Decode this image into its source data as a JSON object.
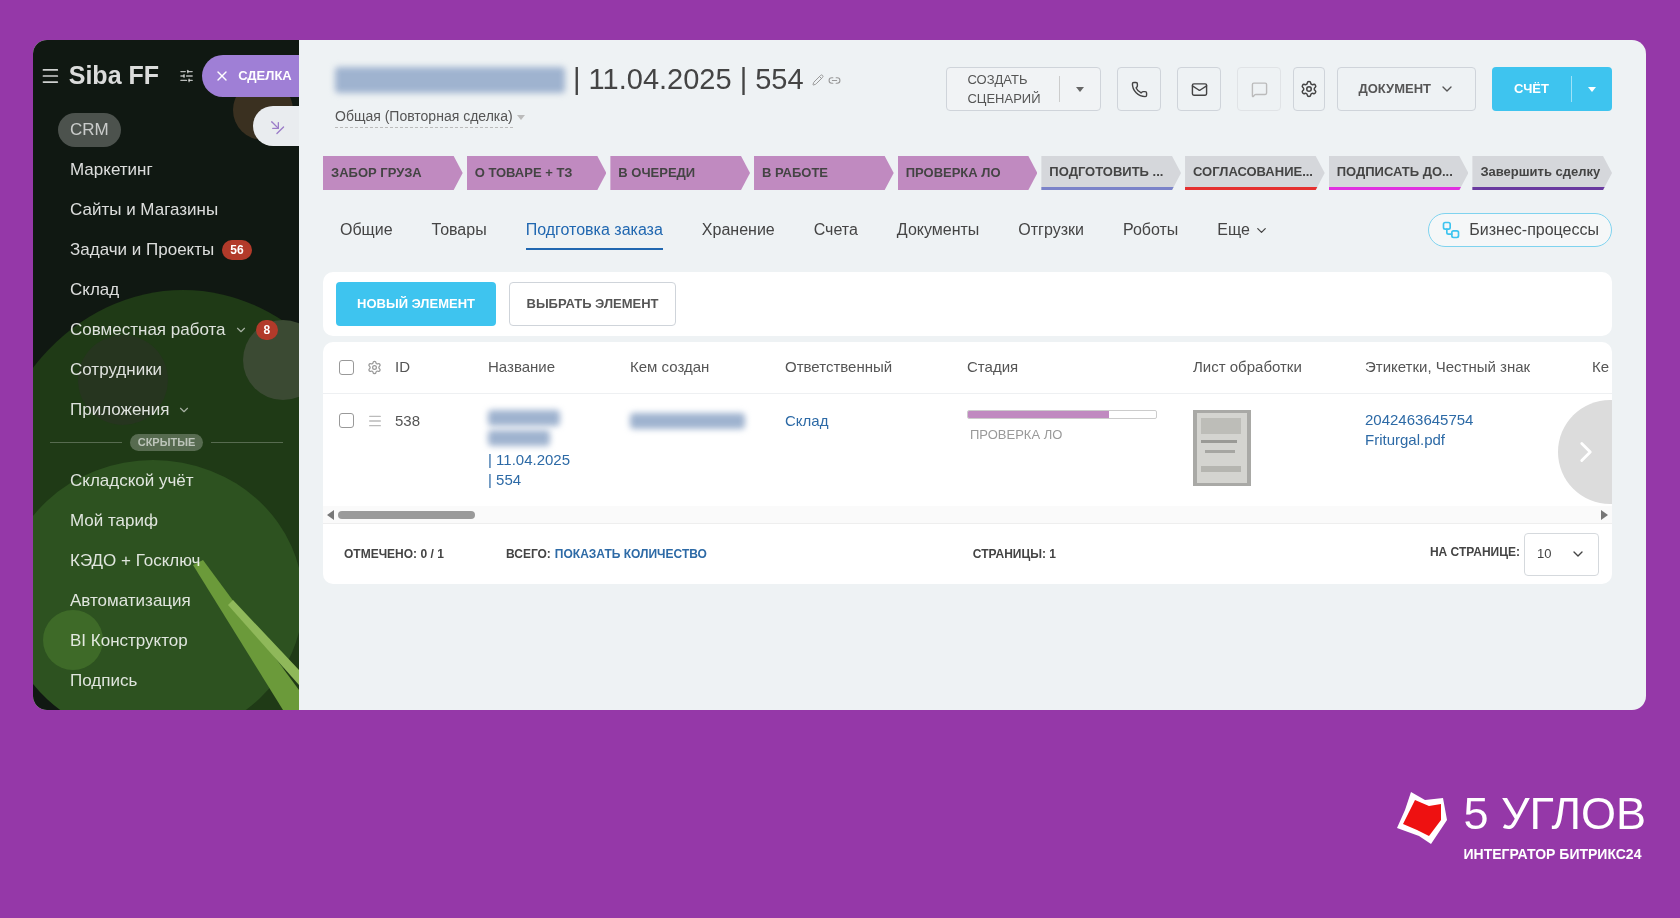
{
  "sidebar": {
    "title": "Siba FF",
    "close_chip": "СДЕЛКА",
    "items": [
      {
        "label": "CRM",
        "selected": true
      },
      {
        "label": "Маркетинг",
        "selected": false
      },
      {
        "label": "Сайты и Магазины",
        "selected": false
      },
      {
        "label": "Задачи и Проекты",
        "selected": false,
        "badge": "56"
      },
      {
        "label": "Склад",
        "selected": false
      },
      {
        "label": "Совместная работа",
        "selected": false,
        "expandable": true,
        "badge": "8"
      },
      {
        "label": "Сотрудники",
        "selected": false
      },
      {
        "label": "Приложения",
        "selected": false,
        "expandable": true
      }
    ],
    "hidden_label": "СКРЫТЫЕ",
    "hidden_items": [
      {
        "label": "Складской учёт",
        "selected": false
      },
      {
        "label": "Мой тариф",
        "selected": false
      },
      {
        "label": "КЭДО + Госключ",
        "selected": false
      },
      {
        "label": "Автоматизация",
        "selected": false
      },
      {
        "label": "BI Конструктор",
        "selected": false
      },
      {
        "label": "Подпись",
        "selected": false
      }
    ]
  },
  "deal": {
    "title_visible": "| 11.04.2025 | 554",
    "category": "Общая (Повторная сделка)"
  },
  "toolbar": {
    "scenario": "СОЗДАТЬ СЦЕНАРИЙ",
    "document": "ДОКУМЕНТ",
    "invoice": "СЧЁТ"
  },
  "stages": [
    {
      "label": "ЗАБОР ГРУЗА",
      "reached": true,
      "color": "#c08ac0"
    },
    {
      "label": "О ТОВАРЕ + ТЗ",
      "reached": true,
      "color": "#c08ac0"
    },
    {
      "label": "В ОЧЕРЕДИ",
      "reached": true,
      "color": "#c08ac0"
    },
    {
      "label": "В РАБОТЕ",
      "reached": true,
      "color": "#c08ac0"
    },
    {
      "label": "ПРОВЕРКА ЛО",
      "reached": true,
      "color": "#c08ac0"
    },
    {
      "label": "ПОДГОТОВИТЬ ...",
      "reached": false,
      "color": "#7b83c9"
    },
    {
      "label": "СОГЛАСОВАНИЕ...",
      "reached": false,
      "color": "#e53030"
    },
    {
      "label": "ПОДПИСАТЬ ДО...",
      "reached": false,
      "color": "#e030e0"
    },
    {
      "label": "Завершить сделку",
      "reached": false,
      "color": "#6a3aa0"
    }
  ],
  "tabs": [
    {
      "label": "Общие",
      "selected": false
    },
    {
      "label": "Товары",
      "selected": false
    },
    {
      "label": "Подготовка заказа",
      "selected": true
    },
    {
      "label": "Хранение",
      "selected": false
    },
    {
      "label": "Счета",
      "selected": false
    },
    {
      "label": "Документы",
      "selected": false
    },
    {
      "label": "Отгрузки",
      "selected": false
    },
    {
      "label": "Роботы",
      "selected": false
    },
    {
      "label": "Еще",
      "selected": false,
      "expandable": true
    }
  ],
  "bp_button": "Бизнес-процессы",
  "actions": {
    "new": "НОВЫЙ ЭЛЕМЕНТ",
    "pick": "ВЫБРАТЬ ЭЛЕМЕНТ"
  },
  "table": {
    "all_checked": false,
    "columns": [
      "ID",
      "Название",
      "Кем создан",
      "Ответственный",
      "Стадия",
      "Лист обработки",
      "Этикетки, Честный знак",
      "Ке"
    ],
    "rows": [
      {
        "checked": false,
        "id": "538",
        "name_visible": "| 11.04.2025 | 554",
        "responsible": "Склад",
        "stage": "ПРОВЕРКА ЛО",
        "level": 0.75,
        "labels": [
          "2042463645754",
          "Friturgal.pdf"
        ]
      }
    ]
  },
  "footer": {
    "marked_label": "ОТМЕЧЕНО:",
    "marked": "0 / 1",
    "total_label": "ВСЕГО:",
    "total_link": "ПОКАЗАТЬ КОЛИЧЕСТВО",
    "pages_label": "СТРАНИЦЫ:",
    "pages": "1",
    "per_page_label": "НА СТРАНИЦЕ:",
    "per_page": "10"
  },
  "brand": {
    "name": "5 УГЛОВ",
    "tagline": "ИНТЕГРАТОР БИТРИКС24"
  }
}
